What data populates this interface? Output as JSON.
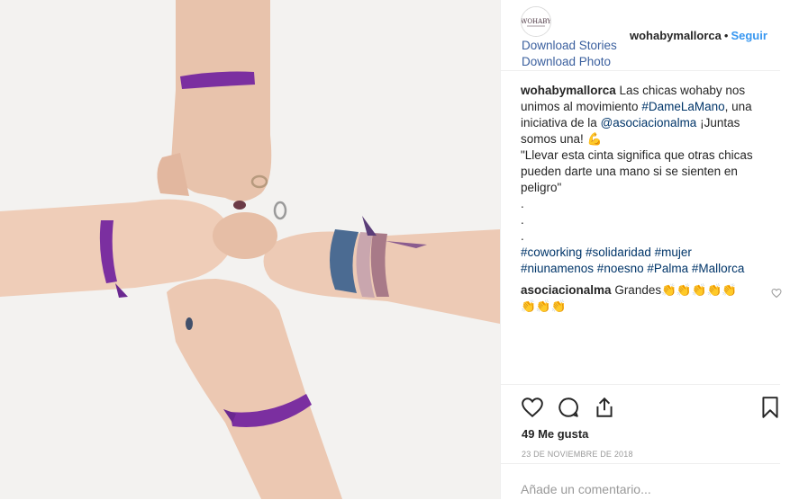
{
  "post": {
    "username": "wohabymallorca",
    "separator": "•",
    "follow_label": "Seguir",
    "avatar_text": "WOHABY"
  },
  "downloads": {
    "stories_label": "Download Stories",
    "photo_label": "Download Photo"
  },
  "caption": {
    "username": "wohabymallorca",
    "line1": " Las chicas wohaby nos",
    "line2_pre": "unimos al movimiento ",
    "hashtag_main": "#DameLaMano",
    "line2_post": ", una",
    "line3_pre": "iniciativa de la ",
    "mention": "@asociacionalma",
    "line3_post": " ¡Juntas",
    "line4": "somos una! 💪",
    "line5": "\"Llevar esta cinta significa que otras chicas",
    "line6": "pueden darte una mano si se sienten en",
    "line7": "peligro\"",
    "dots": [
      ".",
      ".",
      "."
    ],
    "tags_line1": "#coworking #solidaridad #mujer",
    "tags_line2": "#niunamenos #noesno #Palma #Mallorca"
  },
  "comment": {
    "username": "asociacionalma",
    "text_line1": " Grandes👏👏👏👏👏",
    "text_line2": "👏👏👏"
  },
  "stats": {
    "likes": "49 Me gusta",
    "date": "23 DE NOVIEMBRE DE 2018"
  },
  "add_comment": {
    "placeholder": "Añade un comentario..."
  },
  "icons": {
    "like": "heart-icon",
    "comment": "comment-icon",
    "share": "share-icon",
    "save": "bookmark-icon"
  },
  "colors": {
    "link": "#3a5f9e",
    "follow": "#3897f0",
    "hashtag": "#003569",
    "ribbon": "#7b2fa0"
  }
}
